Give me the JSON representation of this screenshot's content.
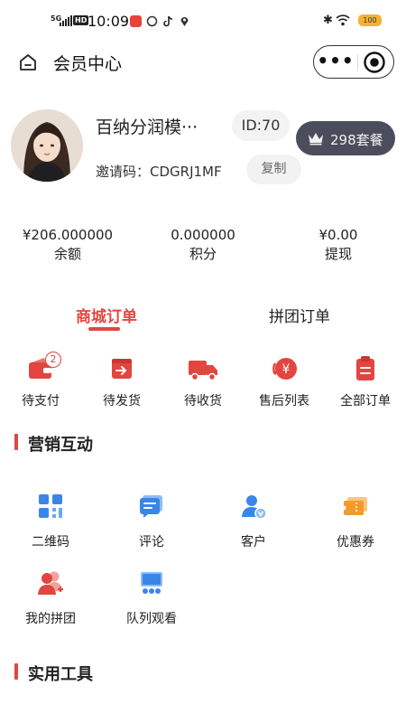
{
  "status_bar": {
    "network": "5G",
    "hd": "HD",
    "time": "10:09",
    "battery": "100"
  },
  "nav": {
    "title": "会员中心",
    "more": "•••"
  },
  "profile": {
    "nickname": "百纳分润模···",
    "id": "ID:70",
    "package": "298套餐",
    "invite_label": "邀请码：",
    "invite_code": "CDGRJ1MF",
    "copy": "复制"
  },
  "stats": [
    {
      "value": "¥206.000000",
      "label": "余额"
    },
    {
      "value": "0.000000",
      "label": "积分"
    },
    {
      "value": "¥0.00",
      "label": "提现"
    }
  ],
  "order_tabs": {
    "mall": "商城订单",
    "group": "拼团订单"
  },
  "orders": [
    {
      "label": "待支付",
      "icon": "wallet-icon",
      "badge": "2"
    },
    {
      "label": "待发货",
      "icon": "box-icon"
    },
    {
      "label": "待收货",
      "icon": "truck-icon"
    },
    {
      "label": "售后列表",
      "icon": "refund-icon"
    },
    {
      "label": "全部订单",
      "icon": "clipboard-icon"
    }
  ],
  "marketing": {
    "title": "营销互动",
    "items": [
      {
        "label": "二维码",
        "icon": "qrcode-icon"
      },
      {
        "label": "评论",
        "icon": "comment-icon"
      },
      {
        "label": "客户",
        "icon": "customer-icon"
      },
      {
        "label": "优惠券",
        "icon": "coupon-icon"
      },
      {
        "label": "我的拼团",
        "icon": "group-icon"
      },
      {
        "label": "队列观看",
        "icon": "queue-icon"
      }
    ]
  },
  "tools": {
    "title": "实用工具"
  },
  "colors": {
    "accent": "#e2463f",
    "vip_bg": "#4c4d5c",
    "icon_blue": "#3a86e8",
    "icon_orange": "#f39a2b"
  }
}
